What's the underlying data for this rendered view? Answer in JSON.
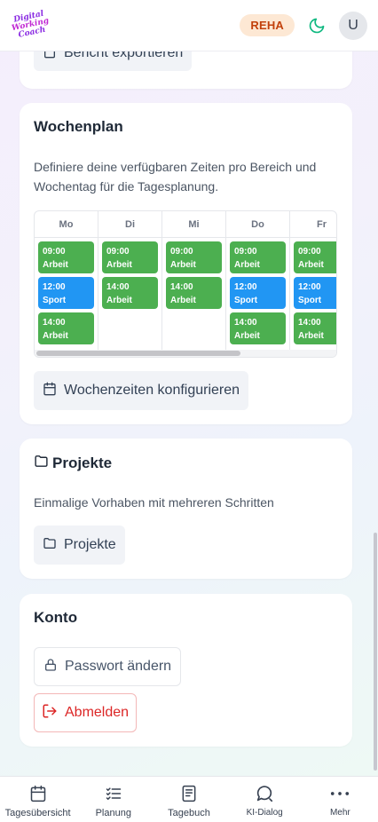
{
  "header": {
    "logo_lines": [
      "Digital",
      "Working",
      "Coach"
    ],
    "badge": "REHA",
    "avatar_initial": "U",
    "icons": {
      "theme": "moon-icon"
    }
  },
  "report_card": {
    "export_label": "Bericht exportieren"
  },
  "weekplan": {
    "title": "Wochenplan",
    "description": "Definiere deine verfügbaren Zeiten pro Bereich und Wochentag für die Tagesplanung.",
    "days": [
      {
        "name": "Mo",
        "slots": [
          {
            "time": "09:00",
            "label": "Arbeit",
            "type": "work"
          },
          {
            "time": "12:00",
            "label": "Sport",
            "type": "sport"
          },
          {
            "time": "14:00",
            "label": "Arbeit",
            "type": "work"
          }
        ]
      },
      {
        "name": "Di",
        "slots": [
          {
            "time": "09:00",
            "label": "Arbeit",
            "type": "work"
          },
          {
            "time": "14:00",
            "label": "Arbeit",
            "type": "work"
          }
        ]
      },
      {
        "name": "Mi",
        "slots": [
          {
            "time": "09:00",
            "label": "Arbeit",
            "type": "work"
          },
          {
            "time": "14:00",
            "label": "Arbeit",
            "type": "work"
          }
        ]
      },
      {
        "name": "Do",
        "slots": [
          {
            "time": "09:00",
            "label": "Arbeit",
            "type": "work"
          },
          {
            "time": "12:00",
            "label": "Sport",
            "type": "sport"
          },
          {
            "time": "14:00",
            "label": "Arbeit",
            "type": "work"
          }
        ]
      },
      {
        "name": "Fr",
        "slots": [
          {
            "time": "09:00",
            "label": "Arbeit",
            "type": "work"
          },
          {
            "time": "12:00",
            "label": "Sport",
            "type": "sport"
          },
          {
            "time": "14:00",
            "label": "Arbeit",
            "type": "work"
          }
        ]
      }
    ],
    "configure_label": "Wochenzeiten konfigurieren"
  },
  "projects": {
    "title": "Projekte",
    "description": "Einmalige Vorhaben mit mehreren Schritten",
    "button_label": "Projekte"
  },
  "account": {
    "title": "Konto",
    "change_password": "Passwort ändern",
    "logout": "Abmelden"
  },
  "bottom_nav": {
    "items": [
      {
        "label": "Tagesübersicht",
        "icon": "calendar-icon"
      },
      {
        "label": "Planung",
        "icon": "checklist-icon"
      },
      {
        "label": "Tagebuch",
        "icon": "book-icon"
      },
      {
        "label": "KI-Dialog",
        "icon": "chat-icon"
      },
      {
        "label": "Mehr",
        "icon": "more-icon"
      }
    ]
  },
  "colors": {
    "work": "#4caf50",
    "sport": "#2196f3",
    "badge_bg": "#fde8d4",
    "badge_text": "#c2410c",
    "danger": "#dc2626",
    "moon": "#10b981"
  }
}
